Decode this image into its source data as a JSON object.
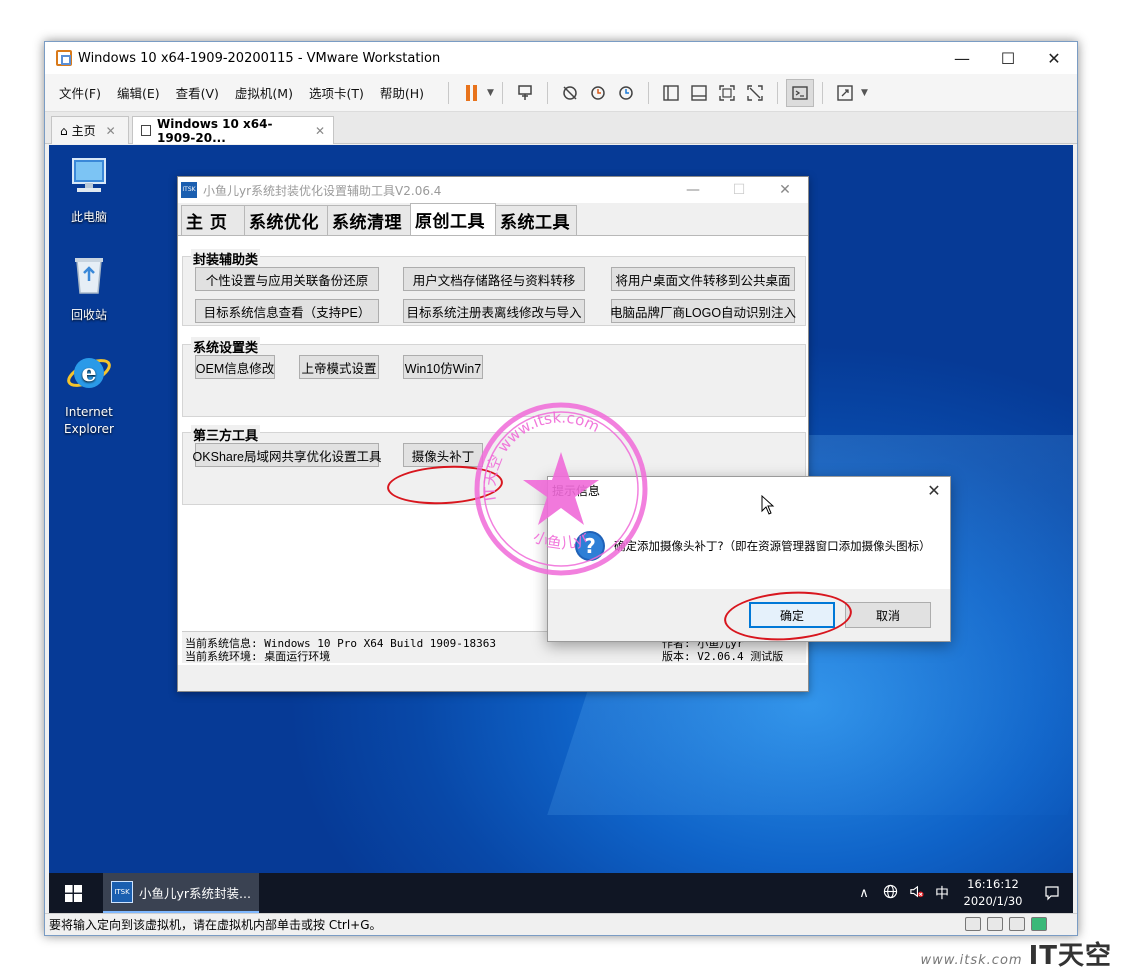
{
  "vm": {
    "title": "Windows 10 x64-1909-20200115 - VMware Workstation",
    "controls": {
      "minimize": "—",
      "maximize": "☐",
      "close": "✕"
    },
    "menu": [
      "文件(F)",
      "编辑(E)",
      "查看(V)",
      "虚拟机(M)",
      "选项卡(T)",
      "帮助(H)"
    ],
    "tabs": [
      {
        "label": "主页",
        "close": "✕"
      },
      {
        "label": "Windows 10 x64-1909-20...",
        "close": "✕"
      }
    ],
    "status_text": "要将输入定向到该虚拟机，请在虚拟机内部单击或按 Ctrl+G。"
  },
  "desktop": {
    "icons": [
      {
        "label": "此电脑"
      },
      {
        "label": "回收站"
      },
      {
        "label": "Internet Explorer"
      }
    ]
  },
  "tool": {
    "title": "小鱼儿yr系统封装优化设置辅助工具V2.06.4",
    "controls": {
      "minimize": "—",
      "maximize": "☐",
      "close": "✕"
    },
    "app_icon_text": "ITSK",
    "tabs": [
      "主 页",
      "系统优化",
      "系统清理",
      "原创工具",
      "系统工具"
    ],
    "active_tab": 3,
    "groups": {
      "packaging": {
        "label": "封装辅助类",
        "buttons": [
          "个性设置与应用关联备份还原",
          "用户文档存储路径与资料转移",
          "将用户桌面文件转移到公共桌面",
          "目标系统信息查看（支持PE）",
          "目标系统注册表离线修改与导入",
          "电脑品牌厂商LOGO自动识别注入"
        ]
      },
      "settings": {
        "label": "系统设置类",
        "buttons": [
          "OEM信息修改",
          "上帝模式设置",
          "Win10仿Win7"
        ]
      },
      "third_party": {
        "label": "第三方工具",
        "buttons": [
          "OKShare局域网共享优化设置工具",
          "摄像头补丁"
        ]
      }
    },
    "status": {
      "sys_info": "当前系统信息: Windows 10 Pro X64 Build 1909-18363",
      "sys_env": "当前系统环境: 桌面运行环境",
      "author": "作者: 小鱼儿yr",
      "version": "版本: V2.06.4 测试版"
    }
  },
  "dialog": {
    "title": "提示信息",
    "close": "✕",
    "message": "确定添加摄像头补丁?（即在资源管理器窗口添加摄像头图标）",
    "ok": "确定",
    "cancel": "取消"
  },
  "taskbar": {
    "app_label": "小鱼儿yr系统封装...",
    "ime": "中",
    "time": "16:16:12",
    "date": "2020/1/30"
  },
  "stamp": {
    "top_text": "IT天空 www.itsk.com",
    "bottom_text": "小鱼儿yr"
  },
  "watermark": {
    "url": "www.itsk.com",
    "brand": "IT天空"
  },
  "colors": {
    "accent": "#0078d7",
    "highlight": "#d8161e",
    "stamp": "#f06ad8",
    "pause": "#e8731c"
  }
}
